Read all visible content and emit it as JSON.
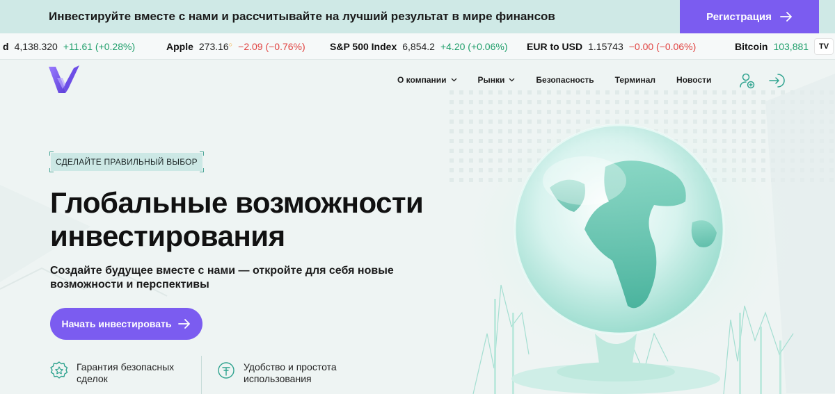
{
  "promo": {
    "text": "Инвестируйте вместе с нами и рассчитывайте на лучший результат в мире финансов",
    "register_label": "Регистрация"
  },
  "ticker": [
    {
      "name": "d",
      "price": "4,138.320",
      "change": "+11.61 (+0.28%)",
      "direction": "up"
    },
    {
      "name": "Apple",
      "price": "273.16",
      "change": "−2.09 (−0.76%)",
      "direction": "down"
    },
    {
      "name": "S&P 500 Index",
      "price": "6,854.2",
      "change": "+4.20 (+0.06%)",
      "direction": "up"
    },
    {
      "name": "EUR to USD",
      "price": "1.15743",
      "change": "−0.00 (−0.06%)",
      "direction": "down"
    },
    {
      "name": "Bitcoin",
      "price": "103,881",
      "change": "",
      "direction": "up"
    }
  ],
  "ticker_badge": "TV",
  "nav": {
    "items": [
      {
        "label": "О компании",
        "dropdown": true
      },
      {
        "label": "Рынки",
        "dropdown": true
      },
      {
        "label": "Безопасность",
        "dropdown": false
      },
      {
        "label": "Терминал",
        "dropdown": false
      },
      {
        "label": "Новости",
        "dropdown": false
      }
    ]
  },
  "hero": {
    "badge": "СДЕЛАЙТЕ ПРАВИЛЬНЫЙ ВЫБОР",
    "headline_line1": "Глобальные возможности",
    "headline_line2": "инвестирования",
    "subhead_line1": "Создайте будущее вместе с нами — откройте для себя новые",
    "subhead_line2": "возможности и перспективы",
    "cta_label": "Начать инвестировать"
  },
  "features": [
    {
      "line1": "Гарантия безопасных",
      "line2": "сделок",
      "icon": "shield-star-icon"
    },
    {
      "line1": "Удобство и простота",
      "line2": "использования",
      "icon": "thumb-tap-icon"
    }
  ],
  "colors": {
    "accent": "#7b5cf0",
    "promo_bg": "#cfe9e6",
    "up": "#1e9e6a",
    "down": "#e0413f",
    "teal": "#2fa38f"
  }
}
